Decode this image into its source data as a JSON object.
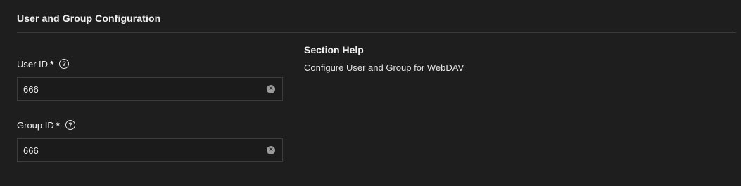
{
  "section": {
    "title": "User and Group Configuration"
  },
  "fields": {
    "user_id": {
      "label": "User ID",
      "required_mark": "*",
      "value": "666",
      "help_icon": "question-circle-icon",
      "clear_icon": "clear-icon"
    },
    "group_id": {
      "label": "Group ID",
      "required_mark": "*",
      "value": "666",
      "help_icon": "question-circle-icon",
      "clear_icon": "clear-icon"
    }
  },
  "help": {
    "title": "Section Help",
    "text": "Configure User and Group for WebDAV"
  },
  "colors": {
    "background": "#1e1e1e",
    "input_background": "#1b1b1b",
    "border": "#3c3c3c",
    "text": "#f0f0f0"
  }
}
